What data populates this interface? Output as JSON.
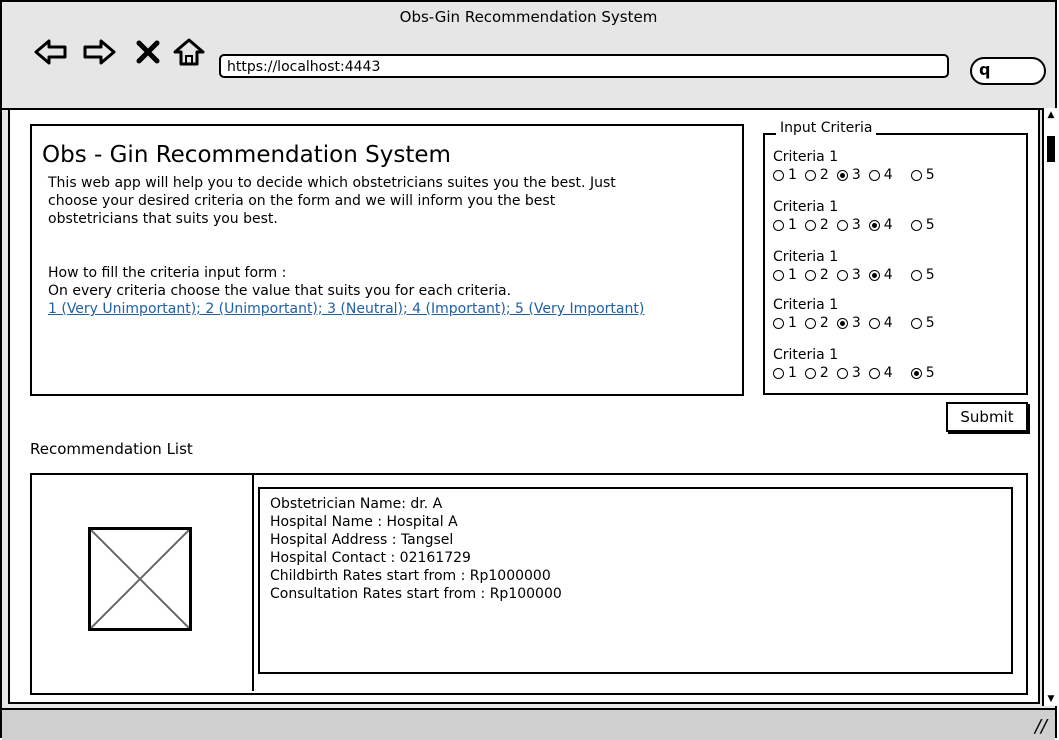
{
  "window": {
    "title": "Obs-Gin Recommendation System"
  },
  "browser": {
    "url": "https://localhost:4443",
    "nav_icons": [
      "back-arrow-icon",
      "forward-arrow-icon",
      "close-x-icon",
      "home-icon"
    ],
    "search_icon": "search-icon"
  },
  "intro": {
    "heading": "Obs - Gin Recommendation System",
    "paragraph1_line1": "This web app will help you to decide which obstetricians suites you the best. Just",
    "paragraph1_line2": "choose your desired criteria on the form and we will inform you the best",
    "paragraph1_line3": "obstetricians that suits you best.",
    "howto_line1": "How to fill the criteria input form :",
    "howto_line2": "On every criteria choose the value that suits you for each criteria.",
    "scale_link": "1 (Very Unimportant); 2 (Unimportant); 3 (Neutral); 4 (Important); 5 (Very Important)"
  },
  "criteria": {
    "legend": "Input Criteria",
    "items": [
      {
        "label": "Criteria 1",
        "options": [
          "1",
          "2",
          "3",
          "4",
          "5"
        ],
        "selected": "3"
      },
      {
        "label": "Criteria 1",
        "options": [
          "1",
          "2",
          "3",
          "4",
          "5"
        ],
        "selected": "4"
      },
      {
        "label": "Criteria 1",
        "options": [
          "1",
          "2",
          "3",
          "4",
          "5"
        ],
        "selected": "4"
      },
      {
        "label": "Criteria 1",
        "options": [
          "1",
          "2",
          "3",
          "4",
          "5"
        ],
        "selected": "3"
      },
      {
        "label": "Criteria 1",
        "options": [
          "1",
          "2",
          "3",
          "4",
          "5"
        ],
        "selected": "5"
      }
    ],
    "submit_label": "Submit"
  },
  "recommendations": {
    "label": "Recommendation List",
    "items": [
      {
        "name": "Obstetrician Name: dr. A",
        "hospital": "Hospital Name : Hospital A",
        "address": "Hospital Address : Tangsel",
        "contact": "Hospital Contact : 02161729",
        "childbirth": "Childbirth Rates start from : Rp1000000",
        "consultation": "Consultation Rates start from : Rp100000"
      }
    ]
  }
}
